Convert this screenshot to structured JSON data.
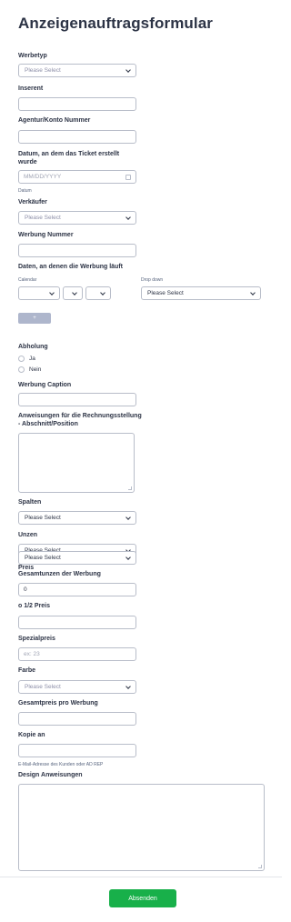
{
  "form_title": "Anzeigenauftragsformular",
  "werbetyp": {
    "label": "Werbetyp",
    "value": "Please Select"
  },
  "inserent": {
    "label": "Inserent",
    "value": ""
  },
  "agentur": {
    "label": "Agentur/Konto Nummer",
    "value": ""
  },
  "datum": {
    "label_line1": "Datum, an dem das Ticket erstellt",
    "label_line2": "wurde",
    "placeholder": "MM/DD/YYYY",
    "sublabel": "Datum"
  },
  "verkaeufer": {
    "label": "Verkäufer",
    "value": "Please Select"
  },
  "werbung_nummer": {
    "label": "Werbung Nummer",
    "value": ""
  },
  "daten": {
    "label": "Daten, an denen die Werbung läuft",
    "calendar_label": "Calendar",
    "dropdown_label": "Drop down",
    "dropdown_value": "Please Select",
    "add_button": "+"
  },
  "abholung": {
    "label": "Abholung",
    "options": [
      "Ja",
      "Nein"
    ]
  },
  "caption": {
    "label": "Werbung Caption",
    "value": ""
  },
  "anweisungen": {
    "label_line1": "Anweisungen für die Rechnungsstellung",
    "label_line2": "- Abschnitt/Position",
    "value": ""
  },
  "spalten": {
    "label": "Spalten",
    "value": "Please Select"
  },
  "unzen": {
    "label": "Unzen",
    "value": "Please Select"
  },
  "preis": {
    "label": "Preis",
    "value": "Please Select"
  },
  "gesamtunzen": {
    "label": "Gesamtunzen der Werbung",
    "value": "0"
  },
  "halb_preis": {
    "label": "o 1/2 Preis",
    "value": ""
  },
  "spezialpreis": {
    "label": "Spezialpreis",
    "placeholder": "ex: 23"
  },
  "farbe": {
    "label": "Farbe",
    "value": "Please Select"
  },
  "gesamtpreis": {
    "label": "Gesamtpreis pro Werbung",
    "value": ""
  },
  "kopie": {
    "label": "Kopie an",
    "value": "",
    "sublabel": "E-Mail-Adresse des Kunden oder AD REP"
  },
  "design": {
    "label": "Design Anweisungen",
    "value": ""
  },
  "submit_label": "Absenden"
}
